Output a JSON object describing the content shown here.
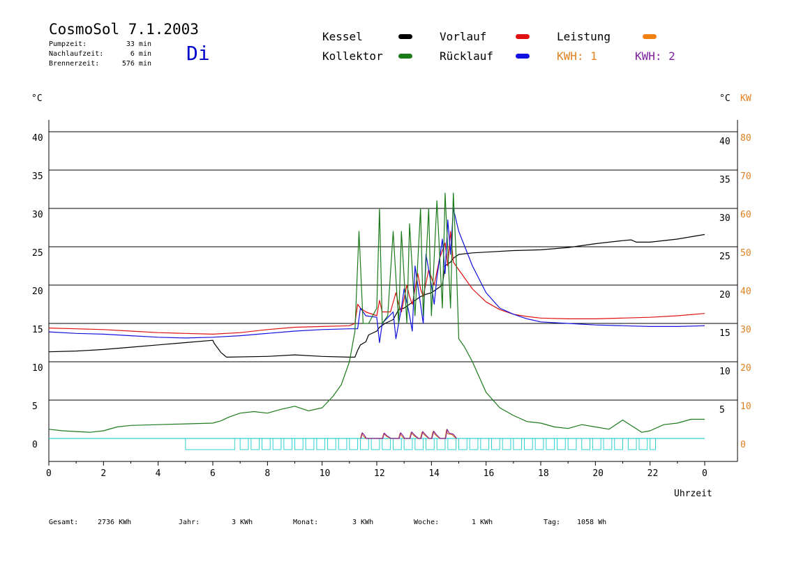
{
  "header": {
    "title": "CosmoSol 7.1.2003",
    "day": "Di",
    "stats": [
      {
        "label": "Pumpzeit:",
        "value": "33 min"
      },
      {
        "label": "Nachlaufzeit:",
        "value": "6 min"
      },
      {
        "label": "Brennerzeit:",
        "value": "576 min"
      }
    ]
  },
  "legend": {
    "kessel": {
      "label": "Kessel",
      "color": "#000000"
    },
    "kollektor": {
      "label": "Kollektor",
      "color": "#1a7a1a"
    },
    "vorlauf": {
      "label": "Vorlauf",
      "color": "#e01010"
    },
    "ruecklauf": {
      "label": "Rücklauf",
      "color": "#1010e0"
    },
    "leistung": {
      "label": "Leistung",
      "color": "#f08010"
    },
    "kwh1": {
      "label": "KWH: 1",
      "color": "#e08020"
    },
    "kwh2": {
      "label": "KWH: 2",
      "color": "#8020a0"
    }
  },
  "axes": {
    "left_unit": "°C",
    "right_unit": "°C",
    "right_unit2": "KW",
    "xlabel": "Uhrzeit"
  },
  "footer": [
    {
      "label": "Gesamt:",
      "value": "2736 KWh"
    },
    {
      "label": "Jahr:",
      "value": "3 KWh"
    },
    {
      "label": "Monat:",
      "value": "3 KWh"
    },
    {
      "label": "Woche:",
      "value": "1 KWh"
    },
    {
      "label": "Tag:",
      "value": "1058 Wh"
    }
  ],
  "chart_data": {
    "type": "line",
    "x_unit": "hour",
    "xlim": [
      0,
      24
    ],
    "ylim": [
      0,
      40
    ],
    "y2lim": [
      0,
      80
    ],
    "x_ticks": [
      "0",
      "2",
      "4",
      "6",
      "8",
      "10",
      "12",
      "14",
      "16",
      "18",
      "20",
      "22",
      "0"
    ],
    "y_ticks_left": [
      0,
      5,
      10,
      15,
      20,
      25,
      30,
      35,
      40
    ],
    "y_ticks_right": [
      5,
      10,
      15,
      20,
      25,
      30,
      35,
      40
    ],
    "y2_ticks": [
      0,
      10,
      20,
      30,
      40,
      50,
      60,
      70,
      80
    ],
    "grid": "horizontal",
    "series": [
      {
        "name": "Kessel",
        "color": "#000000",
        "x": [
          0,
          1,
          2,
          3,
          4,
          5,
          6,
          6.05,
          6.3,
          6.5,
          8,
          9,
          10,
          11,
          11.2,
          11.3,
          11.4,
          11.6,
          11.7,
          12,
          12.1,
          12.3,
          12.6,
          12.8,
          13,
          13.2,
          13.4,
          13.6,
          13.8,
          14,
          14.2,
          14.4,
          14.5,
          14.7,
          14.8,
          15,
          15.5,
          16,
          17,
          18,
          19,
          20,
          20.5,
          21,
          21.3,
          21.5,
          22,
          23,
          24
        ],
        "y": [
          11.3,
          11.4,
          11.6,
          11.9,
          12.2,
          12.5,
          12.8,
          12.4,
          11.2,
          10.6,
          10.7,
          10.9,
          10.7,
          10.6,
          10.6,
          11.5,
          12.2,
          12.6,
          13.5,
          14,
          14.5,
          15,
          15.5,
          16.8,
          17,
          17.5,
          18,
          18.5,
          18.8,
          19,
          19.5,
          20,
          22.5,
          23,
          23.5,
          24,
          24.2,
          24.3,
          24.5,
          24.6,
          24.9,
          25.4,
          25.6,
          25.8,
          25.9,
          25.6,
          25.6,
          26,
          26.6
        ]
      },
      {
        "name": "Vorlauf",
        "color": "#e01010",
        "x": [
          0,
          1,
          2,
          3,
          4,
          5,
          6,
          7,
          8,
          9,
          10,
          11,
          11.2,
          11.3,
          11.4,
          11.6,
          12,
          12.1,
          12.2,
          12.5,
          12.7,
          12.8,
          12.9,
          13.1,
          13.2,
          13.3,
          13.5,
          13.6,
          13.7,
          13.9,
          14.1,
          14.3,
          14.5,
          14.6,
          14.7,
          14.8,
          15,
          15.5,
          16,
          16.5,
          17,
          17.5,
          18,
          19,
          20,
          21,
          22,
          23,
          24
        ],
        "y": [
          14.4,
          14.3,
          14.2,
          14.0,
          13.8,
          13.7,
          13.6,
          13.8,
          14.2,
          14.5,
          14.6,
          14.7,
          15,
          17.5,
          17,
          16.5,
          16,
          18,
          16.5,
          16.5,
          19,
          17.5,
          16.5,
          20,
          18.5,
          17.5,
          21.5,
          19.5,
          18.5,
          22,
          20,
          23.5,
          25.5,
          22.5,
          27,
          23,
          22,
          19.5,
          17.8,
          16.8,
          16.2,
          15.9,
          15.7,
          15.6,
          15.6,
          15.7,
          15.8,
          16.0,
          16.3
        ]
      },
      {
        "name": "Rücklauf",
        "color": "#1010e0",
        "x": [
          0,
          1,
          2,
          3,
          4,
          5,
          6,
          7,
          8,
          9,
          10,
          11,
          11.3,
          11.4,
          11.6,
          12,
          12.1,
          12.2,
          12.6,
          12.7,
          12.9,
          13,
          13.2,
          13.3,
          13.4,
          13.6,
          13.7,
          13.8,
          14,
          14.1,
          14.2,
          14.4,
          14.5,
          14.6,
          14.7,
          14.8,
          15,
          15.5,
          16,
          16.5,
          17,
          17.5,
          18,
          19,
          20,
          21,
          22,
          23,
          24
        ],
        "y": [
          13.9,
          13.7,
          13.6,
          13.4,
          13.2,
          13.1,
          13.2,
          13.4,
          13.7,
          14,
          14.2,
          14.3,
          14.3,
          17,
          16,
          15.8,
          12.5,
          15,
          16.5,
          13,
          17,
          19.5,
          16,
          14,
          22.5,
          17.5,
          15,
          24,
          20,
          17.5,
          21,
          26,
          21.5,
          28.5,
          24,
          30,
          27,
          22.5,
          19,
          17,
          16.2,
          15.6,
          15.2,
          15.0,
          14.8,
          14.7,
          14.6,
          14.6,
          14.7
        ]
      },
      {
        "name": "Kollektor",
        "color": "#1a7a1a",
        "x": [
          0,
          0.5,
          1,
          1.5,
          2,
          2.5,
          3,
          4,
          5,
          6,
          6.3,
          6.6,
          7,
          7.5,
          8,
          8.5,
          9,
          9.5,
          10,
          10.4,
          10.7,
          11,
          11.2,
          11.35,
          11.5,
          11.7,
          12,
          12.1,
          12.2,
          12.4,
          12.6,
          12.8,
          12.9,
          13.1,
          13.2,
          13.4,
          13.6,
          13.7,
          13.9,
          14,
          14.2,
          14.4,
          14.5,
          14.7,
          14.8,
          14.9,
          15,
          15.2,
          15.5,
          16,
          16.5,
          17,
          17.5,
          18,
          18.5,
          19,
          19.5,
          20,
          20.5,
          21,
          21.3,
          21.7,
          22,
          22.5,
          23,
          23.5,
          24
        ],
        "y": [
          1.2,
          1,
          0.9,
          0.8,
          1.0,
          1.5,
          1.7,
          1.8,
          1.9,
          2.0,
          2.3,
          2.8,
          3.3,
          3.5,
          3.3,
          3.8,
          4.2,
          3.6,
          4,
          5.5,
          7,
          10,
          14,
          27,
          15,
          15,
          17,
          30,
          15,
          16,
          27,
          15,
          27,
          15,
          28,
          16,
          30,
          16,
          30,
          16,
          31,
          17,
          32,
          17,
          32,
          24,
          13,
          12,
          10,
          6,
          4,
          3,
          2.2,
          2,
          1.5,
          1.3,
          1.8,
          1.5,
          1.2,
          2.4,
          1.7,
          0.8,
          1.0,
          1.8,
          2.0,
          2.5,
          2.5
        ]
      },
      {
        "name": "KWH: 1",
        "color": "#e08020",
        "axis": "right",
        "x": [
          11.4,
          11.45,
          11.5,
          11.6,
          12.2,
          12.25,
          12.35,
          12.5,
          12.8,
          12.85,
          12.9,
          13.0,
          13.2,
          13.25,
          13.35,
          13.5,
          13.6,
          13.65,
          13.75,
          13.9,
          14.0,
          14.05,
          14.15,
          14.3,
          14.5,
          14.55,
          14.6,
          14.75,
          14.9
        ],
        "y": [
          0,
          1.3,
          0.7,
          0,
          0,
          1.2,
          0.6,
          0,
          0,
          1.3,
          0.7,
          0,
          0,
          1.5,
          0.8,
          0,
          0,
          1.6,
          0.9,
          0,
          0,
          1.7,
          0.9,
          0,
          0,
          2.2,
          1.2,
          1,
          0
        ]
      },
      {
        "name": "KWH: 2",
        "color": "#8020a0",
        "axis": "right",
        "x": [
          11.42,
          11.47,
          11.55,
          11.62,
          12.22,
          12.27,
          12.37,
          12.52,
          12.82,
          12.87,
          12.95,
          13.02,
          13.22,
          13.28,
          13.38,
          13.52,
          13.62,
          13.68,
          13.78,
          13.92,
          14.02,
          14.08,
          14.18,
          14.32,
          14.52,
          14.57,
          14.65,
          14.8,
          14.92
        ],
        "y": [
          0,
          1.5,
          0.8,
          0,
          0,
          1.4,
          0.7,
          0,
          0,
          1.5,
          0.8,
          0,
          0,
          1.7,
          0.9,
          0,
          0,
          1.8,
          1,
          0,
          0,
          1.9,
          1,
          0,
          0,
          2.4,
          1.4,
          1.1,
          0
        ]
      }
    ],
    "burner_periods": [
      [
        5,
        6.8
      ],
      [
        7.0,
        7.3
      ],
      [
        7.4,
        7.7
      ],
      [
        7.8,
        8.1
      ],
      [
        8.2,
        8.5
      ],
      [
        8.6,
        8.9
      ],
      [
        9.0,
        9.3
      ],
      [
        9.4,
        9.7
      ],
      [
        9.8,
        10.1
      ],
      [
        10.2,
        10.5
      ],
      [
        10.6,
        10.9
      ],
      [
        11.0,
        11.3
      ],
      [
        11.4,
        11.7
      ],
      [
        11.8,
        12.1
      ],
      [
        12.2,
        12.5
      ],
      [
        12.6,
        12.9
      ],
      [
        13.0,
        13.3
      ],
      [
        13.4,
        13.7
      ],
      [
        13.8,
        14.1
      ],
      [
        14.2,
        14.5
      ],
      [
        14.6,
        14.9
      ],
      [
        15.0,
        15.3
      ],
      [
        15.4,
        15.7
      ],
      [
        15.8,
        16.1
      ],
      [
        16.2,
        16.5
      ],
      [
        16.6,
        16.9
      ],
      [
        17.0,
        17.3
      ],
      [
        17.4,
        17.7
      ],
      [
        17.8,
        18.1
      ],
      [
        18.2,
        18.5
      ],
      [
        18.6,
        18.9
      ],
      [
        19.0,
        19.3
      ],
      [
        19.5,
        19.8
      ],
      [
        19.9,
        20.2
      ],
      [
        20.3,
        20.6
      ],
      [
        20.7,
        21.0
      ],
      [
        21.2,
        21.5
      ],
      [
        21.6,
        21.9
      ],
      [
        22.0,
        22.2
      ]
    ]
  }
}
